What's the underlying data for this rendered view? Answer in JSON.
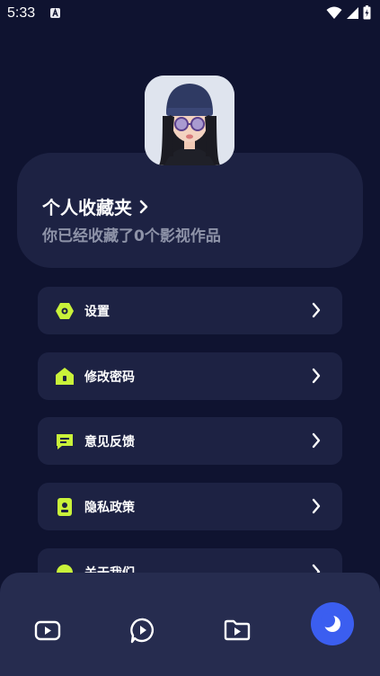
{
  "status_bar": {
    "time": "5:33"
  },
  "profile": {
    "title": "个人收藏夹",
    "subtitle": "你已经收藏了0个影视作品"
  },
  "menu": {
    "items": [
      {
        "label": "设置",
        "icon": "gear-hexagon-icon"
      },
      {
        "label": "修改密码",
        "icon": "lock-home-icon"
      },
      {
        "label": "意见反馈",
        "icon": "message-icon"
      },
      {
        "label": "隐私政策",
        "icon": "privacy-doc-icon"
      },
      {
        "label": "关于我们",
        "icon": "about-icon"
      }
    ]
  },
  "tabs": [
    {
      "name": "home",
      "icon": "video-play-icon"
    },
    {
      "name": "discover",
      "icon": "chat-play-icon"
    },
    {
      "name": "library",
      "icon": "folder-play-icon"
    },
    {
      "name": "mine",
      "icon": "moon-icon",
      "active": true
    }
  ],
  "colors": {
    "background": "#0f1330",
    "card": "#1d2243",
    "accent": "#c9f23a",
    "tab_bar": "#262c4f",
    "active_tab": "#3b5ef0",
    "subtitle": "#8e93a8"
  }
}
